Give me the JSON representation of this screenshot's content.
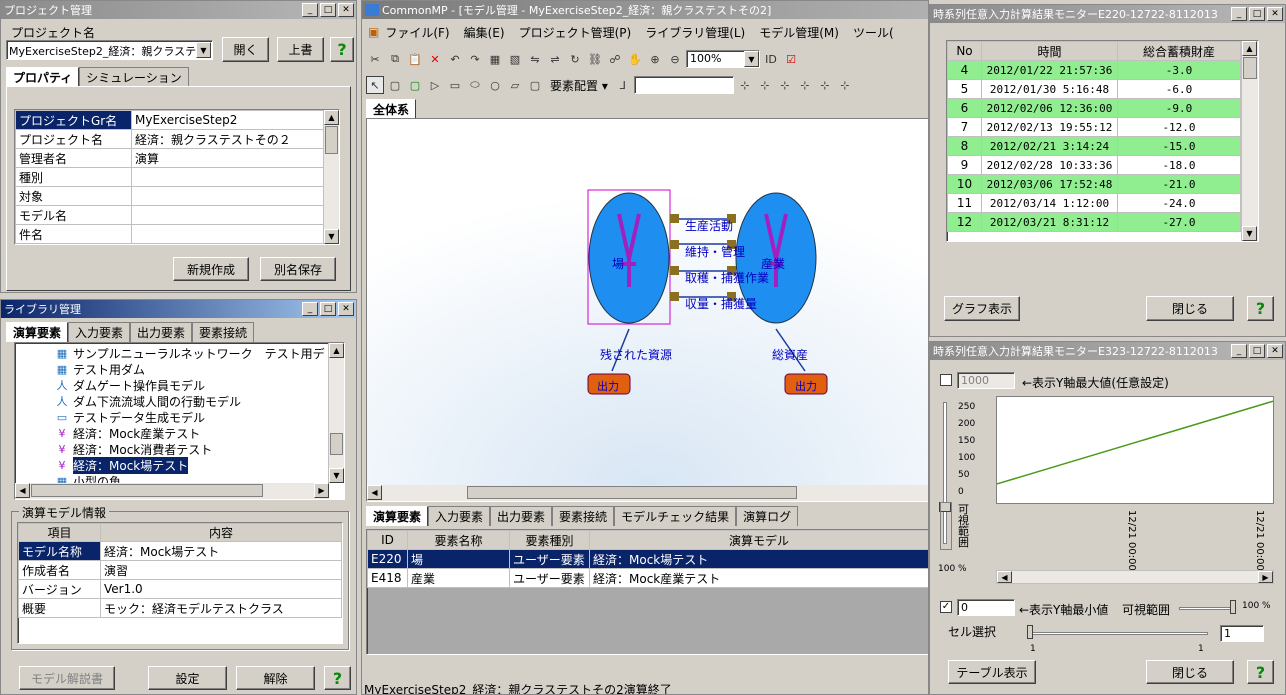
{
  "project_win": {
    "title": "プロジェクト管理",
    "label": "プロジェクト名",
    "combo": "MyExerciseStep2_経済：親クラステ",
    "open": "開く",
    "overwrite": "上書",
    "tabs": [
      "プロパティ",
      "シミュレーション"
    ],
    "props": [
      [
        "プロジェクトGr名",
        "MyExerciseStep2"
      ],
      [
        "プロジェクト名",
        "経済：親クラステストその２"
      ],
      [
        "管理者名",
        "演算"
      ],
      [
        "種別",
        ""
      ],
      [
        "対象",
        ""
      ],
      [
        "モデル名",
        ""
      ],
      [
        "件名",
        ""
      ]
    ],
    "new_btn": "新規作成",
    "saveas_btn": "別名保存"
  },
  "lib_win": {
    "title": "ライブラリ管理",
    "tabs": [
      "演算要素",
      "入力要素",
      "出力要素",
      "要素接続"
    ],
    "tree": [
      "サンプルニューラルネットワーク　テスト用デ",
      "テスト用ダム",
      "ダムゲート操作員モデル",
      "ダム下流流域人間の行動モデル",
      "テストデータ生成モデル",
      "経済：Mock産業テスト",
      "経済：Mock消費者テスト",
      "経済：Mock場テスト",
      "小型の魚"
    ],
    "info_title": "演算モデル情報",
    "info_head": [
      "項目",
      "内容"
    ],
    "info": [
      [
        "モデル名称",
        "経済：Mock場テスト"
      ],
      [
        "作成者名",
        "演習"
      ],
      [
        "バージョン",
        "Ver1.0"
      ],
      [
        "概要",
        "モック：経済モデルテストクラス"
      ]
    ],
    "explain_btn": "モデル解説書",
    "set_btn": "設定",
    "release_btn": "解除"
  },
  "main_win": {
    "title": "CommonMP - [モデル管理 - MyExerciseStep2_経済：親クラステストその2]",
    "menu": [
      "ファイル(F)",
      "編集(E)",
      "プロジェクト管理(P)",
      "ライブラリ管理(L)",
      "モデル管理(M)",
      "ツール("
    ],
    "zoom": "100%",
    "layout": "要素配置 ▾",
    "canvas_tab": "全体系",
    "nodes": {
      "left": "場",
      "right": "産業",
      "out1": "出力",
      "out2": "出力",
      "res1": "残された資源",
      "res2": "総資産"
    },
    "links": [
      "生産活動",
      "維持・管理",
      "取穫・捕獲作業",
      "収量・捕獲量"
    ],
    "bottom_tabs": [
      "演算要素",
      "入力要素",
      "出力要素",
      "要素接続",
      "モデルチェック結果",
      "演算ログ"
    ],
    "grid_head": [
      "ID",
      "要素名称",
      "要素種別",
      "演算モデル"
    ],
    "grid": [
      [
        "E220",
        "場",
        "ユーザー要素",
        "経済：Mock場テスト"
      ],
      [
        "E418",
        "産業",
        "ユーザー要素",
        "経済：Mock産業テスト"
      ]
    ],
    "status": "MyExerciseStep2_経済：親クラステストその2演算終了"
  },
  "mon1": {
    "title": "時系列任意入力計算結果モニターE220-12722-8112013",
    "head": [
      "No",
      "時間",
      "総合蓄積財産"
    ],
    "rows": [
      [
        "4",
        "2012/01/22 21:57:36",
        "-3.0"
      ],
      [
        "5",
        "2012/01/30 5:16:48",
        "-6.0"
      ],
      [
        "6",
        "2012/02/06 12:36:00",
        "-9.0"
      ],
      [
        "7",
        "2012/02/13 19:55:12",
        "-12.0"
      ],
      [
        "8",
        "2012/02/21 3:14:24",
        "-15.0"
      ],
      [
        "9",
        "2012/02/28 10:33:36",
        "-18.0"
      ],
      [
        "10",
        "2012/03/06 17:52:48",
        "-21.0"
      ],
      [
        "11",
        "2012/03/14 1:12:00",
        "-24.0"
      ],
      [
        "12",
        "2012/03/21 8:31:12",
        "-27.0"
      ]
    ],
    "graph_btn": "グラフ表示",
    "close_btn": "閉じる"
  },
  "mon2": {
    "title": "時系列任意入力計算結果モニターE323-12722-8112013",
    "ymax_val": "1000",
    "ymax_label": "←表示Y軸最大値(任意設定)",
    "yticks": [
      "250",
      "200",
      "150",
      "100",
      "50",
      "0"
    ],
    "vis_label": "可視範囲",
    "pct": "100 %",
    "xticks": [
      "12/21 00:00",
      "12/21 00:00"
    ],
    "ymin_val": "0",
    "ymin_label": "←表示Y軸最小値",
    "vis2": "可視範囲",
    "pct2": "100 %",
    "cell_label": "セル選択",
    "cell_val": "1",
    "one_a": "1",
    "one_b": "1",
    "table_btn": "テーブル表示",
    "close_btn": "閉じる",
    "line_color": "#4a9a1a"
  },
  "chart_data": {
    "type": "line",
    "series": [
      {
        "values": [
          45,
          240
        ]
      }
    ],
    "ylim": [
      0,
      250
    ],
    "yticks": [
      0,
      50,
      100,
      150,
      200,
      250
    ],
    "xlabels": [
      "12/21 00:00",
      "12/21 00:00"
    ]
  }
}
